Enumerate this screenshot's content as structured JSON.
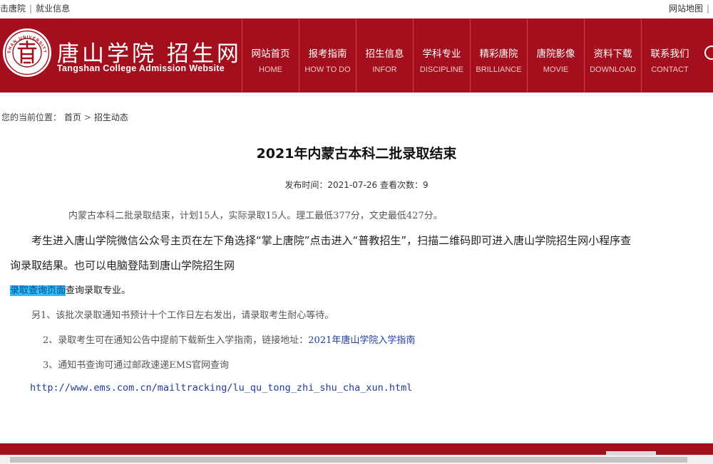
{
  "topbar": {
    "left_items": [
      "击唐院",
      "就业信息"
    ],
    "right_items": [
      "网站地图"
    ]
  },
  "header": {
    "brand_cn": "唐山学院 招生网",
    "brand_en": "Tangshan College Admission Website",
    "logo_ring_text": "SHAN UNIVERSITY",
    "brand_color": "#a30f1c"
  },
  "nav": [
    {
      "cn": "网站首页",
      "en": "HOME"
    },
    {
      "cn": "报考指南",
      "en": "HOW TO DO"
    },
    {
      "cn": "招生信息",
      "en": "INFOR"
    },
    {
      "cn": "学科专业",
      "en": "DISCIPLINE"
    },
    {
      "cn": "精彩唐院",
      "en": "BRILLIANCE"
    },
    {
      "cn": "唐院影像",
      "en": "MOVIE"
    },
    {
      "cn": "资料下载",
      "en": "DOWNLOAD"
    },
    {
      "cn": "联系我们",
      "en": "CONTACT"
    }
  ],
  "breadcrumb": {
    "prefix": "您的当前位置：",
    "home": "首页",
    "current": "招生动态"
  },
  "article": {
    "title": "2021年内蒙古本科二批录取结束",
    "publish_label": "发布时间：",
    "publish_date": "2021-07-26",
    "views_label": "查看次数：",
    "views": "9",
    "p1": "内蒙古本科二批录取结束，计划15人，实际录取15人。理工最低377分，文史最低427分。",
    "p2a": "考生进入唐山学院微信公众号主页在左下角选择“掌上唐院”点击进入“普教招生”，扫描二维码即可进入唐山学院招生网小程序查",
    "p2b": "询录取结果。也可以电脑登陆到唐山学院招生网",
    "p3_link": "录取查询页面",
    "p3_rest": "查询录取专业。",
    "p4": "另1、该批次录取通知书预计十个工作日左右发出，请录取考生耐心等待。",
    "p5_text": "2、录取考生可在通知公告中提前下载新生入学指南，链接地址：",
    "p5_link": "2021年唐山学院入学指南",
    "p6": "3、通知书查询可通过邮政速递EMS官网查询",
    "url": "http://www.ems.com.cn/mailtracking/lu_qu_tong_zhi_shu_cha_xun.html"
  }
}
